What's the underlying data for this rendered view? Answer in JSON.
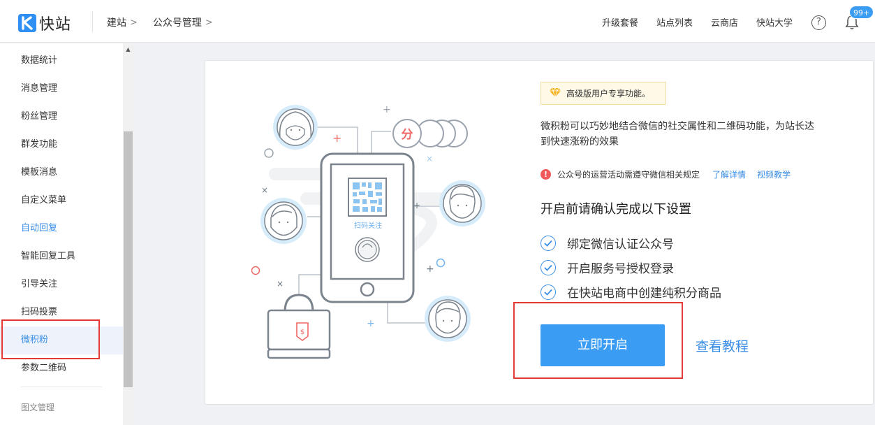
{
  "app": {
    "logo_text": "快站"
  },
  "breadcrumb": [
    {
      "label": "建站"
    },
    {
      "label": "公众号管理"
    }
  ],
  "topnav": [
    {
      "label": "升级套餐"
    },
    {
      "label": "站点列表"
    },
    {
      "label": "云商店"
    },
    {
      "label": "快站大学"
    }
  ],
  "notifications": {
    "badge": "99+",
    "help": "?"
  },
  "sidebar": {
    "items": [
      {
        "label": "数据统计"
      },
      {
        "label": "消息管理"
      },
      {
        "label": "粉丝管理"
      },
      {
        "label": "群发功能"
      },
      {
        "label": "模板消息"
      },
      {
        "label": "自定义菜单"
      },
      {
        "label": "自动回复"
      },
      {
        "label": "智能回复工具"
      },
      {
        "label": "引导关注"
      },
      {
        "label": "扫码投票"
      },
      {
        "label": "微积粉"
      },
      {
        "label": "参数二维码"
      }
    ],
    "section": "图文管理"
  },
  "illustration": {
    "scan_label": "扫码关注",
    "coin_label": "分",
    "tag_label": "$"
  },
  "feature": {
    "tip": "高级版用户专享功能。",
    "description": "微积粉可以巧妙地结合微信的社交属性和二维码功能，为站长达到快速涨粉的效果",
    "notice": "公众号的运营活动需遵守微信相关规定",
    "notice_links": [
      "了解详情",
      "视频教学"
    ],
    "checklist_title": "开启前请确认完成以下设置",
    "checklist": [
      "绑定微信认证公众号",
      "开启服务号授权登录",
      "在快站电商中创建纯积分商品"
    ],
    "primary_button": "立即开启",
    "tutorial_link": "查看教程"
  },
  "colors": {
    "accent": "#3a9cf3",
    "highlight": "#e53935",
    "warning": "#f05a5a"
  }
}
